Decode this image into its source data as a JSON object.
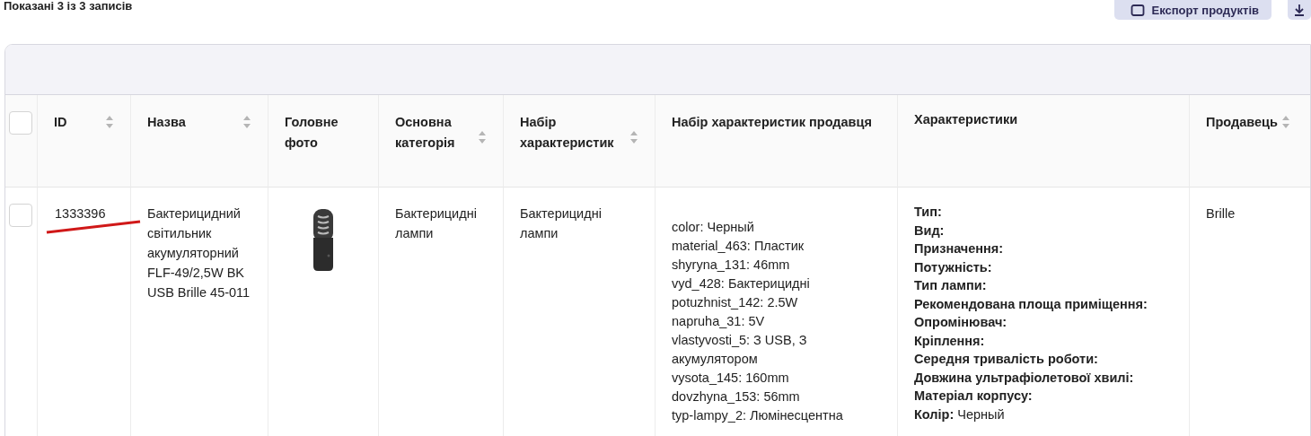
{
  "summary": "Показані 3 із 3 записів",
  "buttons": [
    {
      "kind": "text",
      "label": "Експорт продуктів"
    },
    {
      "kind": "icon"
    }
  ],
  "table": {
    "columns": [
      {
        "kind": "checkbox",
        "checked": false
      },
      {
        "kind": "text",
        "label": "ID",
        "sortable": true
      },
      {
        "kind": "text",
        "label": "Назва",
        "sortable": true
      },
      {
        "kind": "text",
        "label": "Головне фото",
        "sortable": false
      },
      {
        "kind": "text",
        "label": "Основна категорія",
        "sortable": true
      },
      {
        "kind": "text",
        "label": "Набір характеристик",
        "sortable": true
      },
      {
        "kind": "text",
        "label": "Набір характеристик продавця",
        "sortable": false
      },
      {
        "kind": "text",
        "label": "Характеристики",
        "sortable": false
      },
      {
        "kind": "text",
        "label": "Продавець",
        "sortable": true
      }
    ],
    "rows": [
      {
        "checked": false,
        "id": "1333396",
        "id_underlined": true,
        "name": "Бактерицидний світильник акумуляторний FLF-49/2,5W BK USB Brille 45-011",
        "category": "Бактерицидні лампи",
        "attribute_set": "Бактерицидні лампи",
        "seller_attributes": [
          "color: Черный",
          "material_463: Пластик",
          "shyryna_131: 46mm",
          "vyd_428: Бактерицидні",
          "potuzhnist_142: 2.5W",
          "napruha_31: 5V",
          "vlastyvosti_5: З USB, З акумулятором",
          "vysota_145: 160mm",
          "dovzhyna_153: 56mm",
          "typ-lampy_2: Люмінесцентна"
        ],
        "attributes": [
          {
            "label": "Тип:"
          },
          {
            "label": "Вид:"
          },
          {
            "label": "Призначення:"
          },
          {
            "label": "Потужність:"
          },
          {
            "label": "Тип лампи:"
          },
          {
            "label": "Рекомендована площа приміщення:"
          },
          {
            "label": "Опромінювач:"
          },
          {
            "label": "Кріплення:"
          },
          {
            "label": "Середня тривалість роботи:"
          },
          {
            "label": "Довжина ультрафіолетової хвилі:"
          },
          {
            "label": "Матеріал корпусу:"
          },
          {
            "label": "Колір:",
            "value": "Черный"
          }
        ],
        "seller": "Brille"
      }
    ]
  }
}
